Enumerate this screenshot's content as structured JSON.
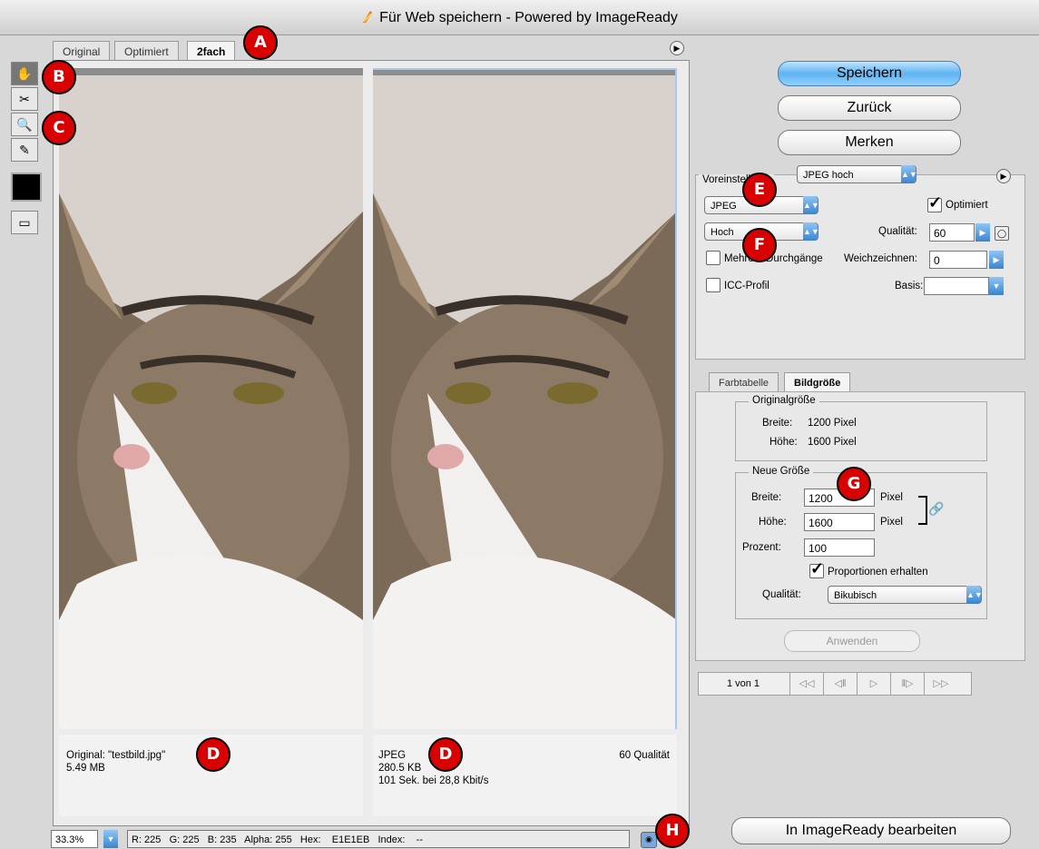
{
  "window": {
    "title": "Für Web speichern - Powered by ImageReady"
  },
  "view_tabs": [
    "Original",
    "Optimiert",
    "2fach"
  ],
  "tools": {
    "hand": "hand-icon",
    "slice": "slice-select-icon",
    "zoom": "zoom-icon",
    "eyedropper": "eyedropper-icon"
  },
  "left_pane": {
    "line1": "Original: \"testbild.jpg\"",
    "line2": "5.49 MB"
  },
  "right_pane": {
    "format": "JPEG",
    "quality": "60 Qualität",
    "size": "280.5 KB",
    "time": "101 Sek. bei 28,8 Kbit/s"
  },
  "buttons": {
    "save": "Speichern",
    "back": "Zurück",
    "remember": "Merken",
    "apply": "Anwenden",
    "edit_in": "In ImageReady bearbeiten"
  },
  "settings": {
    "preset_label": "Voreinstellung:",
    "preset_value": "JPEG hoch",
    "format_value": "JPEG",
    "optimized_label": "Optimiert",
    "quality_preset_value": "Hoch",
    "quality_label": "Qualität:",
    "quality_value": "60",
    "multipass_label": "Mehrere Durchgänge",
    "blur_label": "Weichzeichnen:",
    "blur_value": "0",
    "icc_label": "ICC-Profil",
    "matte_label": "Basis:",
    "matte_value": ""
  },
  "lower_tabs": [
    "Farbtabelle",
    "Bildgröße"
  ],
  "original_size": {
    "legend": "Originalgröße",
    "width_label": "Breite:",
    "width_value": "1200 Pixel",
    "height_label": "Höhe:",
    "height_value": "1600 Pixel"
  },
  "new_size": {
    "legend": "Neue Größe",
    "width_label": "Breite:",
    "width_value": "1200",
    "width_unit": "Pixel",
    "height_label": "Höhe:",
    "height_value": "1600",
    "height_unit": "Pixel",
    "percent_label": "Prozent:",
    "percent_value": "100",
    "constrain_label": "Proportionen erhalten",
    "quality_label": "Qualität:",
    "quality_value": "Bikubisch"
  },
  "animation": {
    "frame_label": "1 von 1",
    "buttons": [
      "◁◁",
      "◁‖",
      "▷",
      "‖▷",
      "▷▷"
    ]
  },
  "status": {
    "zoom": "33.3%",
    "readout": "R: 225   G: 225   B: 235   Alpha: 255   Hex:    E1E1EB   Index:    --"
  },
  "callouts": {
    "a": "A",
    "b": "B",
    "c": "C",
    "d1": "D",
    "d2": "D",
    "e": "E",
    "f": "F",
    "g": "G",
    "h": "H"
  }
}
